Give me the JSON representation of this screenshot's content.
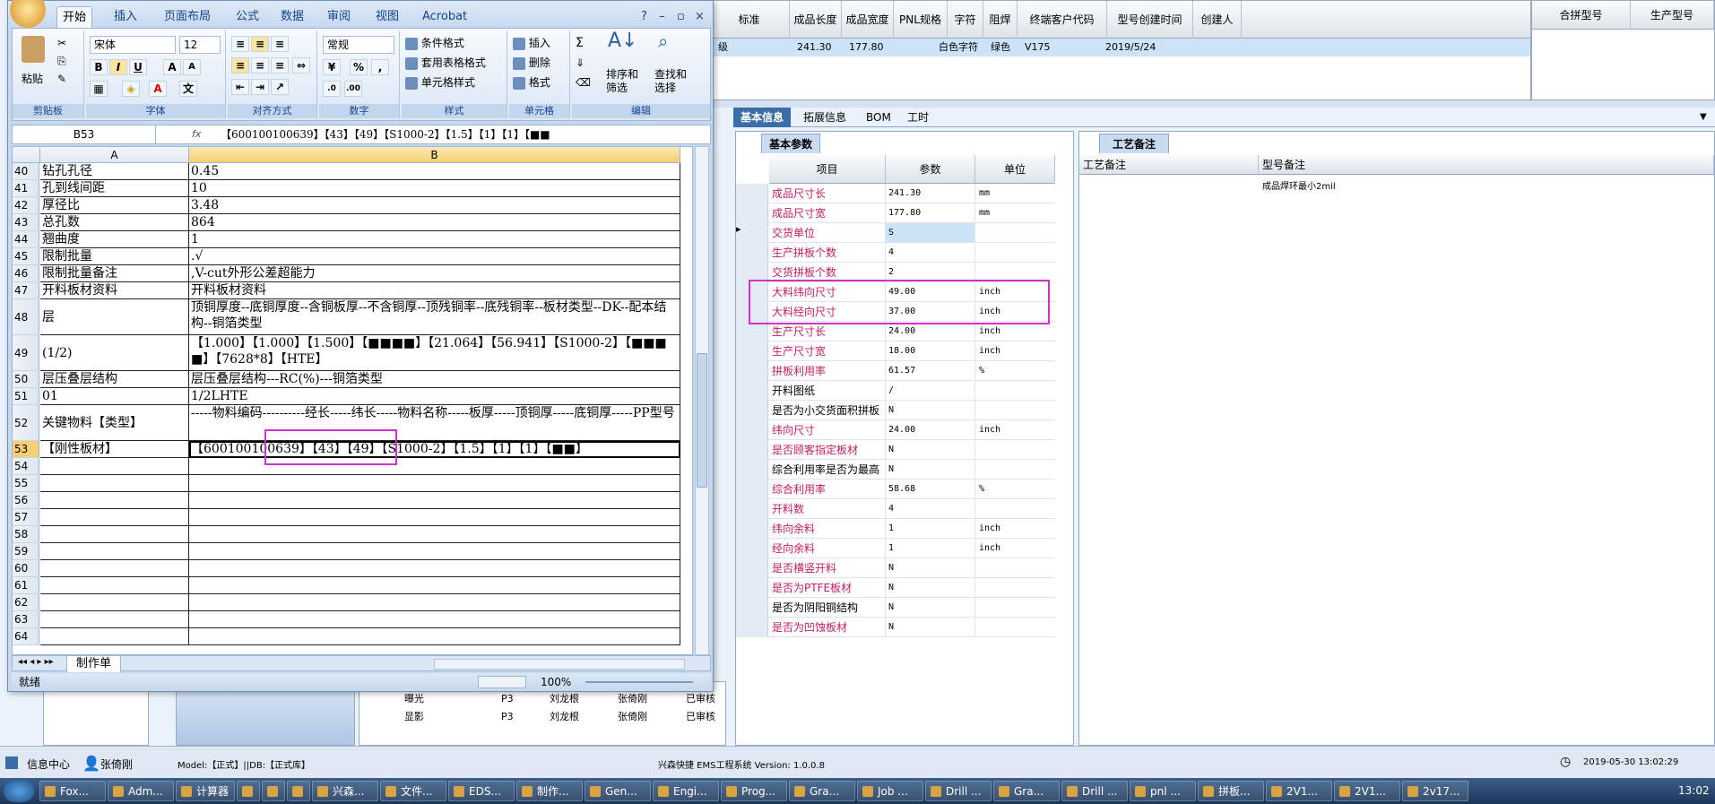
{
  "ems": {
    "top_headers": [
      "标准",
      "成品长度",
      "成品宽度",
      "PNL规格",
      "字符",
      "阻焊",
      "终端客户代码",
      "型号创建时间",
      "创建人"
    ],
    "top_row": [
      "级",
      "241.30",
      "177.80",
      "",
      "白色字符",
      "绿色",
      "V175",
      "2019/5/24",
      ""
    ],
    "right_headers": [
      "合拼型号",
      "生产型号"
    ],
    "tabs": [
      "基本信息",
      "拓展信息",
      "BOM",
      "工时"
    ],
    "params_tab": "基本参数",
    "params_headers": [
      "项目",
      "参数",
      "单位"
    ],
    "params_rows": [
      {
        "name": "成品尺寸长",
        "value": "241.30",
        "unit": "mm",
        "red": true
      },
      {
        "name": "成品尺寸宽",
        "value": "177.80",
        "unit": "mm",
        "red": true
      },
      {
        "name": "交货单位",
        "value": "S",
        "unit": "",
        "red": true
      },
      {
        "name": "生产拼板个数",
        "value": "4",
        "unit": "",
        "red": true
      },
      {
        "name": "交货拼板个数",
        "value": "2",
        "unit": "",
        "red": true
      },
      {
        "name": "大料纬向尺寸",
        "value": "49.00",
        "unit": "inch",
        "red": true
      },
      {
        "name": "大料经向尺寸",
        "value": "37.00",
        "unit": "inch",
        "red": true
      },
      {
        "name": "生产尺寸长",
        "value": "24.00",
        "unit": "inch",
        "red": true
      },
      {
        "name": "生产尺寸宽",
        "value": "18.00",
        "unit": "inch",
        "red": true
      },
      {
        "name": "拼板利用率",
        "value": "61.57",
        "unit": "%",
        "red": true
      },
      {
        "name": "开料图纸",
        "value": "/",
        "unit": "",
        "red": false
      },
      {
        "name": "是否为小交货面积拼板",
        "value": "N",
        "unit": "",
        "red": false
      },
      {
        "name": "纬向尺寸",
        "value": "24.00",
        "unit": "inch",
        "red": true
      },
      {
        "name": "是否顾客指定板材",
        "value": "N",
        "unit": "",
        "red": true
      },
      {
        "name": "综合利用率是否为最高",
        "value": "N",
        "unit": "",
        "red": false
      },
      {
        "name": "综合利用率",
        "value": "58.68",
        "unit": "%",
        "red": true
      },
      {
        "name": "开料数",
        "value": "4",
        "unit": "",
        "red": true
      },
      {
        "name": "纬向余料",
        "value": "1",
        "unit": "inch",
        "red": true
      },
      {
        "name": "经向余料",
        "value": "1",
        "unit": "inch",
        "red": true
      },
      {
        "name": "是否横竖开料",
        "value": "N",
        "unit": "",
        "red": true
      },
      {
        "name": "是否为PTFE板材",
        "value": "N",
        "unit": "",
        "red": true
      },
      {
        "name": "是否为阴阳铜结构",
        "value": "N",
        "unit": "",
        "red": false
      },
      {
        "name": "是否为凹蚀板材",
        "value": "N",
        "unit": "",
        "red": true
      }
    ],
    "notes_tab": "工艺备注",
    "notes_headers": [
      "工艺备注",
      "型号备注"
    ],
    "notes_value": "成品焊环最小2mil",
    "tree_rows": [
      {
        "name": "曝光",
        "col2": "P3",
        "col3": "刘龙根",
        "col4": "张倚刚",
        "col5": "已审核"
      },
      {
        "name": "显影",
        "col2": "P3",
        "col3": "刘龙根",
        "col4": "张倚刚",
        "col5": "已审核"
      }
    ],
    "status": {
      "info_center": "信息中心",
      "user": "张倚刚",
      "model": "Model:【正式】||DB:【正式库】",
      "app": "兴森快捷 EMS工程系统 Version: 1.0.0.8",
      "datetime": "2019-05-30 13:02:29"
    }
  },
  "excel": {
    "tabs": [
      "开始",
      "插入",
      "页面布局",
      "公式",
      "数据",
      "审阅",
      "视图",
      "Acrobat"
    ],
    "font_name": "宋体",
    "font_size": "12",
    "number_format": "常规",
    "groups": [
      "剪贴板",
      "字体",
      "对齐方式",
      "数字",
      "样式",
      "单元格",
      "编辑"
    ],
    "paste": "粘贴",
    "styles": [
      "条件格式",
      "套用表格格式",
      "单元格样式"
    ],
    "cells_buttons": [
      "插入",
      "删除",
      "格式"
    ],
    "edit_buttons": [
      "排序和\n筛选",
      "查找和\n选择"
    ],
    "name_box": "B53",
    "formula": "【600100100639】【43】【49】【S1000-2】【1.5】【1】【1】【■■",
    "col_headers": [
      "A",
      "B"
    ],
    "rows": [
      {
        "n": "40",
        "a": "钻孔孔径",
        "b": "0.45"
      },
      {
        "n": "41",
        "a": "孔到线间距",
        "b": "10"
      },
      {
        "n": "42",
        "a": "厚径比",
        "b": "3.48"
      },
      {
        "n": "43",
        "a": "总孔数",
        "b": "864"
      },
      {
        "n": "44",
        "a": "翘曲度",
        "b": "1"
      },
      {
        "n": "45",
        "a": "限制批量",
        "b": ".√"
      },
      {
        "n": "46",
        "a": "限制批量备注",
        "b": ",V-cut外形公差超能力"
      },
      {
        "n": "47",
        "a": "开料板材资料",
        "b": "开料板材资料"
      },
      {
        "n": "48",
        "a": "层",
        "b": "顶铜厚度--底铜厚度--含铜板厚--不含铜厚--顶残铜率--底残铜率--板材类型--DK--配本结构--铜箔类型"
      },
      {
        "n": "49",
        "a": "(1/2)",
        "b": "【1.000】【1.000】【1.500】【■■■■】【21.064】【56.941】【S1000-2】【■■■■】【7628*8】【HTE】"
      },
      {
        "n": "50",
        "a": "层压叠层结构",
        "b": "层压叠层结构---RC(%)---铜箔类型"
      },
      {
        "n": "51",
        "a": "01",
        "b": "1/2LHTE"
      },
      {
        "n": "52",
        "a": "关键物料【类型】",
        "b": "-----物料编码----------经长-----纬长-----物料名称-----板厚-----顶铜厚-----底铜厚-----PP型号"
      },
      {
        "n": "53",
        "a": "【刚性板材】",
        "b": "【600100100639】【43】【49】【S1000-2】【1.5】【1】【1】【■■】"
      },
      {
        "n": "54",
        "a": "",
        "b": ""
      },
      {
        "n": "55",
        "a": "",
        "b": ""
      },
      {
        "n": "56",
        "a": "",
        "b": ""
      },
      {
        "n": "57",
        "a": "",
        "b": ""
      },
      {
        "n": "58",
        "a": "",
        "b": ""
      },
      {
        "n": "59",
        "a": "",
        "b": ""
      },
      {
        "n": "60",
        "a": "",
        "b": ""
      },
      {
        "n": "61",
        "a": "",
        "b": ""
      },
      {
        "n": "62",
        "a": "",
        "b": ""
      },
      {
        "n": "63",
        "a": "",
        "b": ""
      },
      {
        "n": "64",
        "a": "",
        "b": ""
      }
    ],
    "sheet_tab": "制作单",
    "ready": "就绪",
    "zoom": "100%"
  },
  "taskbar": [
    "Fox...",
    "Adm...",
    "计算器",
    "",
    "",
    "",
    "兴森...",
    "文件...",
    "EDS...",
    "制作...",
    "Gen...",
    "Engi...",
    "Prog...",
    "Gra...",
    "Job ...",
    "Drill ...",
    "Gra...",
    "Drill ...",
    "pnl ...",
    "拼板...",
    "2V1...",
    "2V1...",
    "2v17..."
  ],
  "clock": "13:02"
}
